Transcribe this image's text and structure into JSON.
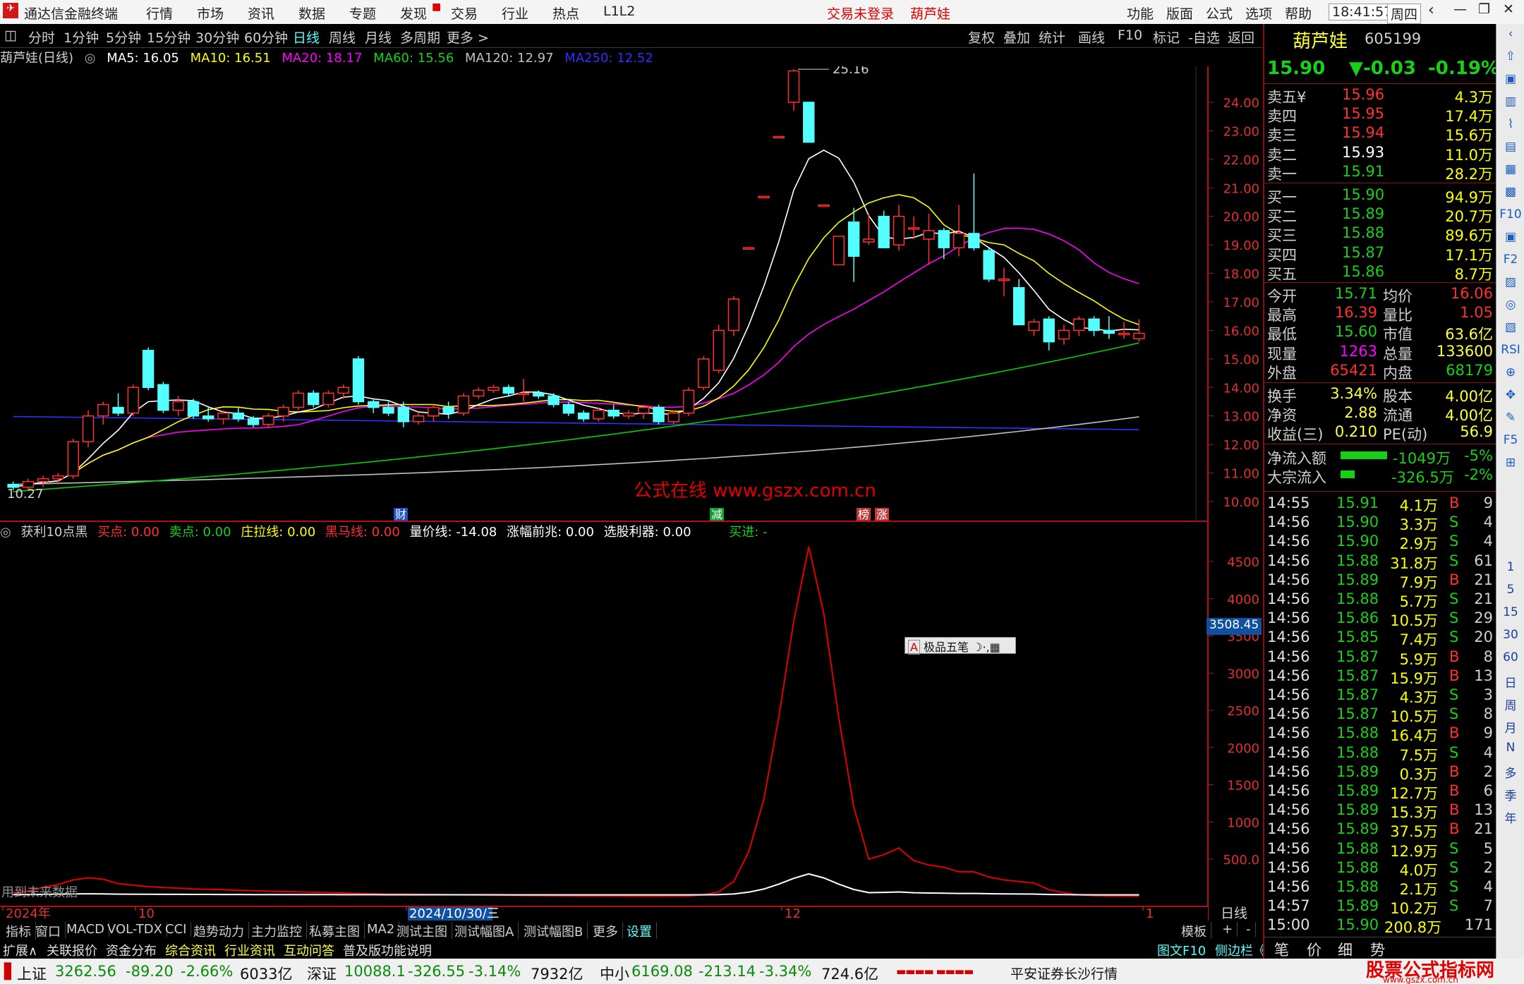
{
  "window": {
    "title": "通达信金融终端",
    "status_login": "交易未登录",
    "stock": "葫芦娃",
    "time": "18:41:57",
    "weekday": "周四",
    "menu": [
      "行情",
      "市场",
      "资讯",
      "数据",
      "专题",
      "发现",
      "交易",
      "行业",
      "热点",
      "L1L2"
    ],
    "right_menu": [
      "功能",
      "版面",
      "公式",
      "选项",
      "帮助"
    ]
  },
  "toolbar": {
    "periods": [
      "分时",
      "1分钟",
      "5分钟",
      "15分钟",
      "30分钟",
      "60分钟",
      "日线",
      "周线",
      "月线",
      "多周期",
      "更多 >"
    ],
    "actions": [
      "复权",
      "叠加",
      "统计",
      "画线",
      "F10",
      "标记",
      "-自选",
      "返回"
    ]
  },
  "ma_legend": {
    "name": "葫芦娃(日线)",
    "ma5": "MA5: 16.05",
    "ma10": "MA10: 16.51",
    "ma20": "MA20: 18.17",
    "ma60": "MA60: 15.56",
    "ma120": "MA120: 12.97",
    "ma250": "MA250: 12.52"
  },
  "main_chart": {
    "high_label": "25.16",
    "low_label": "10.27",
    "watermark": "公式在线  www.gszx.com.cn",
    "yticks": [
      "24.00",
      "23.00",
      "22.00",
      "21.00",
      "20.00",
      "19.00",
      "18.00",
      "17.00",
      "16.00",
      "15.00",
      "14.00",
      "13.00",
      "12.00",
      "11.00",
      "10.00"
    ],
    "markers": [
      "财",
      "减",
      "榜",
      "涨"
    ]
  },
  "indicator": {
    "name": "获利10点黑",
    "buy": "买点: 0.00",
    "sell": "卖点: 0.00",
    "zhuang": "庄拉线: 0.00",
    "heima": "黑马线: 0.00",
    "liangjia": "量价线: -14.08",
    "zhangfu": "涨幅前兆: 0.00",
    "xuangu": "选股利器: 0.00",
    "maijin": "买进: -",
    "yticks": [
      "4500",
      "4000",
      "3500",
      "3000",
      "2500",
      "2000",
      "1500",
      "1000",
      "500.0"
    ],
    "current": "3508.45",
    "future_note": "用到未来数据",
    "ime": "极品五笔"
  },
  "xaxis": {
    "labels": [
      "2024年",
      "10",
      "2024/10/30/三",
      "12",
      "1"
    ],
    "period": "日线"
  },
  "bottom_tabs": [
    "指标",
    "窗口",
    "MACD",
    "VOL-TDX",
    "CCI",
    "趋势动力",
    "主力监控",
    "私募主图",
    "MA2",
    "测试主图",
    "测试幅图A",
    "测试幅图B",
    "更多",
    "设置"
  ],
  "bottom_right": [
    "模板",
    "+",
    "-"
  ],
  "ext_bar": [
    "扩展∧",
    "关联报价",
    "资金分布",
    "综合资讯",
    "行业资讯",
    "互动问答",
    "普及版功能说明"
  ],
  "ext_right": [
    "图文F10",
    "侧边栏《",
    "笔",
    "价",
    "细",
    "势"
  ],
  "status": {
    "sh_name": "上证",
    "sh": "3262.56",
    "sh_chg": "-89.20",
    "sh_pct": "-2.66%",
    "sh_amt": "6033亿",
    "sz_name": "深证",
    "sz": "10088.1",
    "sz_chg": "-326.55",
    "sz_pct": "-3.14%",
    "sz_amt": "7932亿",
    "zx_name": "中小",
    "zx": "6169.08",
    "zx_chg": "-213.14",
    "zx_pct": "-3.34%",
    "zx_amt": "724.6亿",
    "broker": "平安证券长沙行情",
    "logo": "股票公式指标网",
    "logo_url": "www.gszx.com.cn"
  },
  "quote": {
    "name": "葫芦娃",
    "code": "605199",
    "price": "15.90",
    "change": "▼-0.03",
    "pct": "-0.19%",
    "asks": [
      [
        "卖五¥",
        "15.96",
        "4.3万"
      ],
      [
        "卖四",
        "15.95",
        "17.4万"
      ],
      [
        "卖三",
        "15.94",
        "15.6万"
      ],
      [
        "卖二",
        "15.93",
        "11.0万"
      ],
      [
        "卖一",
        "15.91",
        "28.2万"
      ]
    ],
    "bids": [
      [
        "买一",
        "15.90",
        "94.9万"
      ],
      [
        "买二",
        "15.89",
        "20.7万"
      ],
      [
        "买三",
        "15.88",
        "89.6万"
      ],
      [
        "买四",
        "15.87",
        "17.1万"
      ],
      [
        "买五",
        "15.86",
        "8.7万"
      ]
    ],
    "stats": [
      [
        "今开",
        "15.71",
        "均价",
        "16.06"
      ],
      [
        "最高",
        "16.39",
        "量比",
        "1.05"
      ],
      [
        "最低",
        "15.60",
        "市值",
        "63.6亿"
      ],
      [
        "现量",
        "1263",
        "总量",
        "133600"
      ],
      [
        "外盘",
        "65421",
        "内盘",
        "68179"
      ]
    ],
    "stats2": [
      [
        "换手",
        "3.34%",
        "股本",
        "4.00亿"
      ],
      [
        "净资",
        "2.88",
        "流通",
        "4.00亿"
      ],
      [
        "收益(三)",
        "0.210",
        "PE(动)",
        "56.9"
      ]
    ],
    "flow": [
      [
        "净流入额",
        "-1049万",
        "-5%"
      ],
      [
        "大宗流入",
        "-326.5万",
        "-2%"
      ]
    ],
    "ticks": [
      [
        "14:55",
        "15.91",
        "4.1万",
        "B",
        "9"
      ],
      [
        "14:56",
        "15.90",
        "3.3万",
        "S",
        "4"
      ],
      [
        "14:56",
        "15.90",
        "2.9万",
        "S",
        "4"
      ],
      [
        "14:56",
        "15.88",
        "31.8万",
        "S",
        "61"
      ],
      [
        "14:56",
        "15.89",
        "7.9万",
        "B",
        "21"
      ],
      [
        "14:56",
        "15.88",
        "5.7万",
        "S",
        "21"
      ],
      [
        "14:56",
        "15.86",
        "10.5万",
        "S",
        "29"
      ],
      [
        "14:56",
        "15.85",
        "7.4万",
        "S",
        "20"
      ],
      [
        "14:56",
        "15.87",
        "5.9万",
        "B",
        "8"
      ],
      [
        "14:56",
        "15.87",
        "15.9万",
        "B",
        "13"
      ],
      [
        "14:56",
        "15.87",
        "4.3万",
        "S",
        "3"
      ],
      [
        "14:56",
        "15.87",
        "10.5万",
        "S",
        "8"
      ],
      [
        "14:56",
        "15.88",
        "16.4万",
        "B",
        "9"
      ],
      [
        "14:56",
        "15.88",
        "7.5万",
        "S",
        "4"
      ],
      [
        "14:56",
        "15.89",
        "0.3万",
        "B",
        "2"
      ],
      [
        "14:56",
        "15.89",
        "12.7万",
        "B",
        "6"
      ],
      [
        "14:56",
        "15.89",
        "15.3万",
        "B",
        "13"
      ],
      [
        "14:56",
        "15.89",
        "37.5万",
        "B",
        "21"
      ],
      [
        "14:56",
        "15.88",
        "12.9万",
        "S",
        "5"
      ],
      [
        "14:56",
        "15.88",
        "4.0万",
        "S",
        "2"
      ],
      [
        "14:56",
        "15.88",
        "2.1万",
        "S",
        "4"
      ],
      [
        "14:57",
        "15.89",
        "10.2万",
        "S",
        "7"
      ],
      [
        "15:00",
        "15.90",
        "200.8万",
        "",
        "171"
      ]
    ]
  },
  "side_tools": [
    "1",
    "5",
    "15",
    "30",
    "60",
    "日",
    "周",
    "月",
    "N",
    "多",
    "季",
    "年"
  ],
  "colors": {
    "up": "#ff3030",
    "down": "#54ffff",
    "ma5": "#ffffff",
    "ma10": "#ffff00",
    "ma20": "#ff00ff",
    "ma60": "#00d000",
    "ma120": "#c0c0c0",
    "ma250": "#3030ff"
  },
  "chart_data": {
    "type": "candlestick",
    "title": "葫芦娃(日线)",
    "ylim": [
      10,
      25.5
    ],
    "candles": [
      [
        10.6,
        10.7,
        10.4,
        10.5
      ],
      [
        10.5,
        10.8,
        10.4,
        10.7
      ],
      [
        10.7,
        10.9,
        10.5,
        10.8
      ],
      [
        10.8,
        11.0,
        10.6,
        10.9
      ],
      [
        10.9,
        12.2,
        10.8,
        12.1
      ],
      [
        12.1,
        13.2,
        11.9,
        13.0
      ],
      [
        13.0,
        13.5,
        12.7,
        13.4
      ],
      [
        13.3,
        13.8,
        13.0,
        13.1
      ],
      [
        13.1,
        14.1,
        13.0,
        14.0
      ],
      [
        15.3,
        15.4,
        13.9,
        14.0
      ],
      [
        14.1,
        14.2,
        13.1,
        13.2
      ],
      [
        13.2,
        13.7,
        13.0,
        13.5
      ],
      [
        13.5,
        13.6,
        12.9,
        13.0
      ],
      [
        13.0,
        13.3,
        12.8,
        12.9
      ],
      [
        12.9,
        13.2,
        12.7,
        13.1
      ],
      [
        13.1,
        13.3,
        12.8,
        12.9
      ],
      [
        12.9,
        13.0,
        12.6,
        12.7
      ],
      [
        12.7,
        13.1,
        12.6,
        13.0
      ],
      [
        13.0,
        13.4,
        12.8,
        13.3
      ],
      [
        13.3,
        13.9,
        13.2,
        13.8
      ],
      [
        13.8,
        13.9,
        13.3,
        13.4
      ],
      [
        13.4,
        13.9,
        13.3,
        13.8
      ],
      [
        13.8,
        14.1,
        13.6,
        14.0
      ],
      [
        15.0,
        15.1,
        13.4,
        13.5
      ],
      [
        13.5,
        13.6,
        13.1,
        13.3
      ],
      [
        13.3,
        13.5,
        13.0,
        13.1
      ],
      [
        13.3,
        13.5,
        12.6,
        12.8
      ],
      [
        12.8,
        13.1,
        12.7,
        13.0
      ],
      [
        13.0,
        13.4,
        12.8,
        13.3
      ],
      [
        13.3,
        13.5,
        12.9,
        13.1
      ],
      [
        13.1,
        13.8,
        13.0,
        13.7
      ],
      [
        13.7,
        14.0,
        13.6,
        13.9
      ],
      [
        13.9,
        14.1,
        13.8,
        14.0
      ],
      [
        14.0,
        14.1,
        13.7,
        13.8
      ],
      [
        13.8,
        14.3,
        13.5,
        13.8
      ],
      [
        13.8,
        13.9,
        13.6,
        13.7
      ],
      [
        13.7,
        13.8,
        13.3,
        13.4
      ],
      [
        13.4,
        13.5,
        13.0,
        13.1
      ],
      [
        13.1,
        13.2,
        12.8,
        12.9
      ],
      [
        12.9,
        13.3,
        12.8,
        13.2
      ],
      [
        13.2,
        13.4,
        12.9,
        13.0
      ],
      [
        13.0,
        13.2,
        12.9,
        13.1
      ],
      [
        13.1,
        13.4,
        12.9,
        13.3
      ],
      [
        13.3,
        13.4,
        12.7,
        12.8
      ],
      [
        12.8,
        13.2,
        12.7,
        13.1
      ],
      [
        13.1,
        14.0,
        13.0,
        13.9
      ],
      [
        14.0,
        15.1,
        13.9,
        15.0
      ],
      [
        14.6,
        16.2,
        14.5,
        16.0
      ],
      [
        16.0,
        17.2,
        15.8,
        17.1
      ],
      [
        18.9,
        18.9,
        18.9,
        18.9
      ],
      [
        20.7,
        20.7,
        20.7,
        20.7
      ],
      [
        22.8,
        22.8,
        22.8,
        22.8
      ],
      [
        24.0,
        25.16,
        23.7,
        25.1
      ],
      [
        24.0,
        24.0,
        22.6,
        22.6
      ],
      [
        20.4,
        20.4,
        20.4,
        20.4
      ],
      [
        18.3,
        19.3,
        18.3,
        19.3
      ],
      [
        19.8,
        20.3,
        17.7,
        18.6
      ],
      [
        19.1,
        20.1,
        19.0,
        19.2
      ],
      [
        20.0,
        20.2,
        18.9,
        18.9
      ],
      [
        19.0,
        20.4,
        18.8,
        20.0
      ],
      [
        19.6,
        20.0,
        19.2,
        19.6
      ],
      [
        19.2,
        20.1,
        18.3,
        19.5
      ],
      [
        19.5,
        19.6,
        18.5,
        18.9
      ],
      [
        18.9,
        20.4,
        18.6,
        19.4
      ],
      [
        19.4,
        21.5,
        18.8,
        18.9
      ],
      [
        18.8,
        18.9,
        17.7,
        17.8
      ],
      [
        17.8,
        18.2,
        17.2,
        17.8
      ],
      [
        17.5,
        17.8,
        16.2,
        16.2
      ],
      [
        16.0,
        16.4,
        15.8,
        16.3
      ],
      [
        16.4,
        16.5,
        15.3,
        15.6
      ],
      [
        15.7,
        16.2,
        15.5,
        16.0
      ],
      [
        16.0,
        16.5,
        15.8,
        16.4
      ],
      [
        16.4,
        16.5,
        15.8,
        16.0
      ],
      [
        16.0,
        16.5,
        15.7,
        15.9
      ],
      [
        15.9,
        16.3,
        15.7,
        15.9
      ],
      [
        15.71,
        16.39,
        15.6,
        15.9
      ]
    ]
  }
}
